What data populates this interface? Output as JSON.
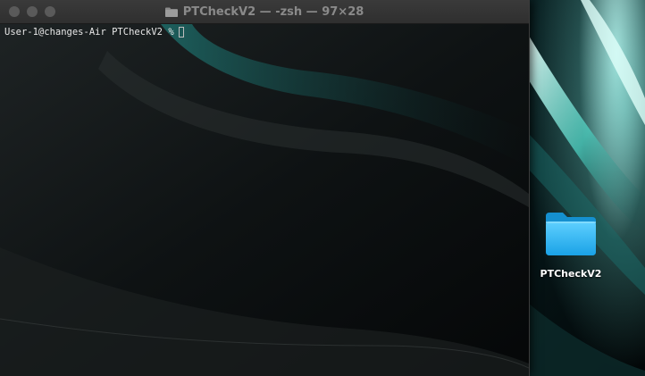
{
  "window": {
    "title": "PTCheckV2 — -zsh — 97×28"
  },
  "terminal": {
    "prompt": "User-1@changes-Air PTCheckV2 %"
  },
  "desktop": {
    "items": [
      {
        "label": "PTCheckV2",
        "icon": "folder-icon"
      }
    ]
  },
  "colors": {
    "folder_blue": "#27b4f0",
    "traffic_inactive": "#5a5a5a",
    "titlebar": "#333333",
    "wallpaper_accent": "#5fe3d4"
  }
}
